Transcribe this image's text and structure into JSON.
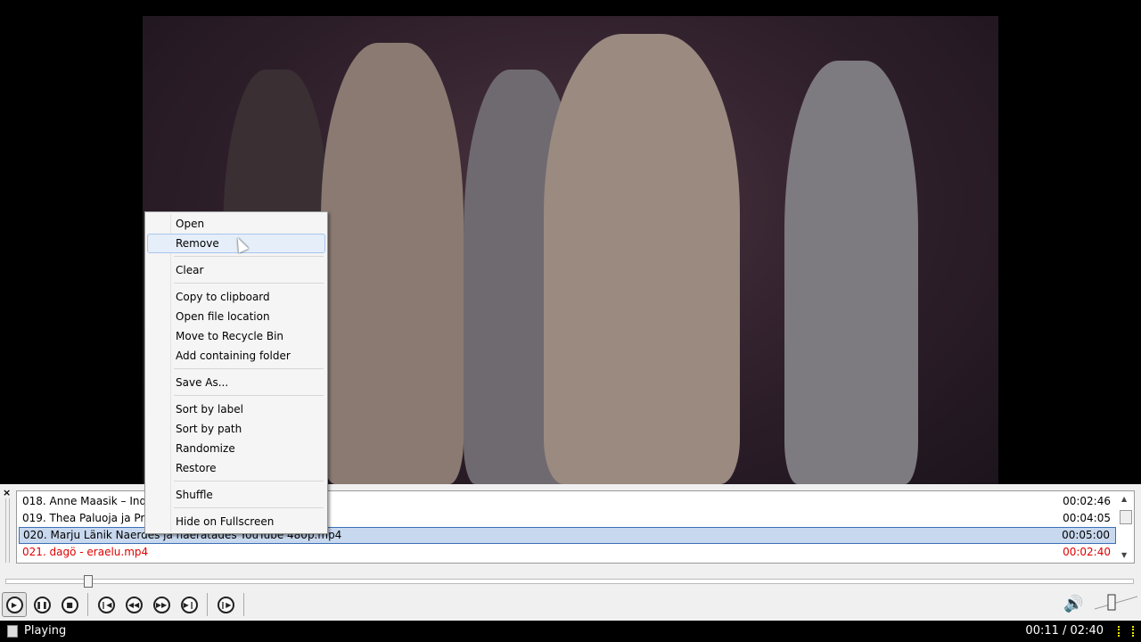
{
  "playlist": {
    "close_label": "×",
    "rows": [
      {
        "title": "018. Anne Maasik – Indiaa",
        "duration": "00:02:46"
      },
      {
        "title": "019. Thea Paluoja ja Proov",
        "duration": "00:04:05"
      },
      {
        "title": "020. Marju Länik Naerdes ja naeratades   YouTube 480p.mp4",
        "duration": "00:05:00"
      },
      {
        "title": "021. dagö - eraelu.mp4",
        "duration": "00:02:40"
      }
    ]
  },
  "context_menu": {
    "items": [
      "Open",
      "Remove",
      "Clear",
      "Copy to clipboard",
      "Open file location",
      "Move to Recycle Bin",
      "Add containing folder",
      "Save As...",
      "Sort by label",
      "Sort by path",
      "Randomize",
      "Restore",
      "Shuffle",
      "Hide on Fullscreen"
    ]
  },
  "seek": {
    "position_fraction": 0.073
  },
  "controls": {
    "icons": [
      "play",
      "pause",
      "stop",
      "previous",
      "rewind",
      "fast-forward",
      "next",
      "frame-step"
    ]
  },
  "status": {
    "state": "Playing",
    "time": "00:11 / 02:40"
  },
  "colors": {
    "playing": "#e00000",
    "selected": "#c8d8ee"
  }
}
